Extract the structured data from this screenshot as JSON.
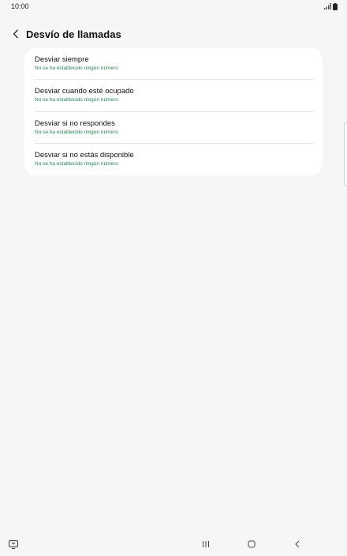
{
  "status_bar": {
    "time": "10:00",
    "icons": [
      "signal-icon",
      "battery-icon"
    ]
  },
  "header": {
    "title": "Desvío de llamadas",
    "back_icon": "chevron-left-icon"
  },
  "forwarding_options": [
    {
      "title": "Desviar siempre",
      "subtitle": "No se ha establecido ningún número"
    },
    {
      "title": "Desviar cuando esté ocupado",
      "subtitle": "No se ha establecido ningún número"
    },
    {
      "title": "Desviar si no respondes",
      "subtitle": "No se ha establecido ningún número"
    },
    {
      "title": "Desviar si no estás disponible",
      "subtitle": "No se ha establecido ningún número"
    }
  ],
  "navigation_bar": {
    "icons": [
      "keyboard-switch-icon",
      "recent-apps-icon",
      "home-icon",
      "back-icon"
    ]
  },
  "colors": {
    "background": "#f6f6f6",
    "card": "#ffffff",
    "subtitle_accent": "#1c8a55"
  }
}
